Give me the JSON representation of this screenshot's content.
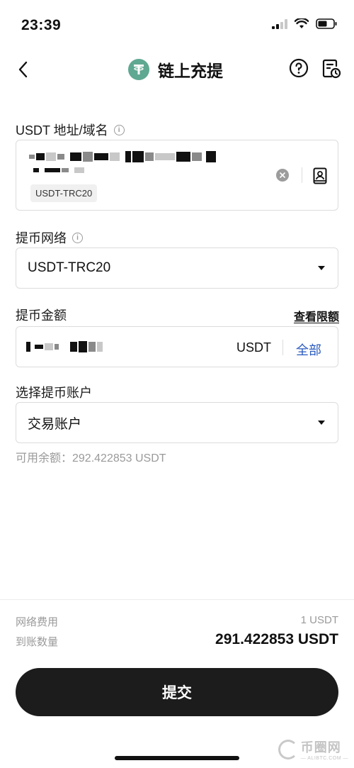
{
  "status_bar": {
    "time": "23:39"
  },
  "nav": {
    "title": "链上充提"
  },
  "address": {
    "label": "USDT 地址/域名",
    "network_tag": "USDT-TRC20"
  },
  "network": {
    "label": "提币网络",
    "selected": "USDT-TRC20"
  },
  "amount": {
    "label": "提币金额",
    "limits_link": "查看限额",
    "unit": "USDT",
    "all_button": "全部"
  },
  "account": {
    "label": "选择提币账户",
    "selected": "交易账户"
  },
  "available_balance": "可用余额：292.422853 USDT",
  "summary": {
    "fee_label": "网络费用",
    "fee_value": "1 USDT",
    "received_label": "到账数量",
    "received_value": "291.422853 USDT"
  },
  "submit_label": "提交",
  "watermark": {
    "main": "币圈网",
    "sub": "— ALIBTC.COM —"
  },
  "colors": {
    "accent_blue": "#2a5bbf",
    "tether_green": "#5fa891",
    "button_dark": "#1c1c1c"
  }
}
